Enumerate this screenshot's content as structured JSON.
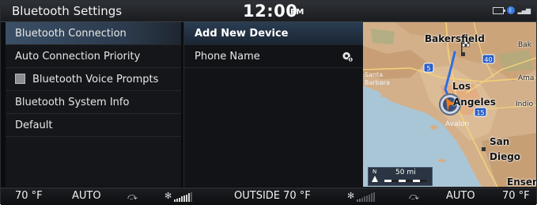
{
  "header": {
    "title": "Bluetooth Settings",
    "time": "12:00",
    "ampm": "PM"
  },
  "status_icons": [
    "battery-icon",
    "bluetooth-icon",
    "signal-icon"
  ],
  "left_menu": {
    "items": [
      {
        "label": "Bluetooth Connection",
        "selected": true
      },
      {
        "label": "Auto Connection Priority",
        "selected": false
      },
      {
        "label": "Bluetooth Voice Prompts",
        "selected": false,
        "checkbox": true
      },
      {
        "label": "Bluetooth System Info",
        "selected": false
      },
      {
        "label": "Default",
        "selected": false
      }
    ]
  },
  "device_list": {
    "header": "Add New Device",
    "items": [
      {
        "label": "Phone Name",
        "icon": "phone-settings-icon"
      }
    ]
  },
  "map": {
    "labels": [
      "Bakersfield",
      "Los",
      "Angeles",
      "Santa",
      "Barbara",
      "San",
      "Diego",
      "Bak",
      "Ama",
      "Indio",
      "Avalon",
      "Ensen"
    ],
    "highways": [
      "5",
      "40",
      "15"
    ],
    "scale": "50 mi",
    "north": "N"
  },
  "climate": {
    "left_temp": "70 °F",
    "left_mode": "AUTO",
    "outside": "OUTSIDE  70 °F",
    "right_mode": "AUTO",
    "right_temp": "70 °F",
    "left_fan_level": 7,
    "right_fan_level": 2
  },
  "colors": {
    "selected_row": "#3b4f66",
    "map_water": "#a9c6d6",
    "route": "#2f6ee0"
  }
}
